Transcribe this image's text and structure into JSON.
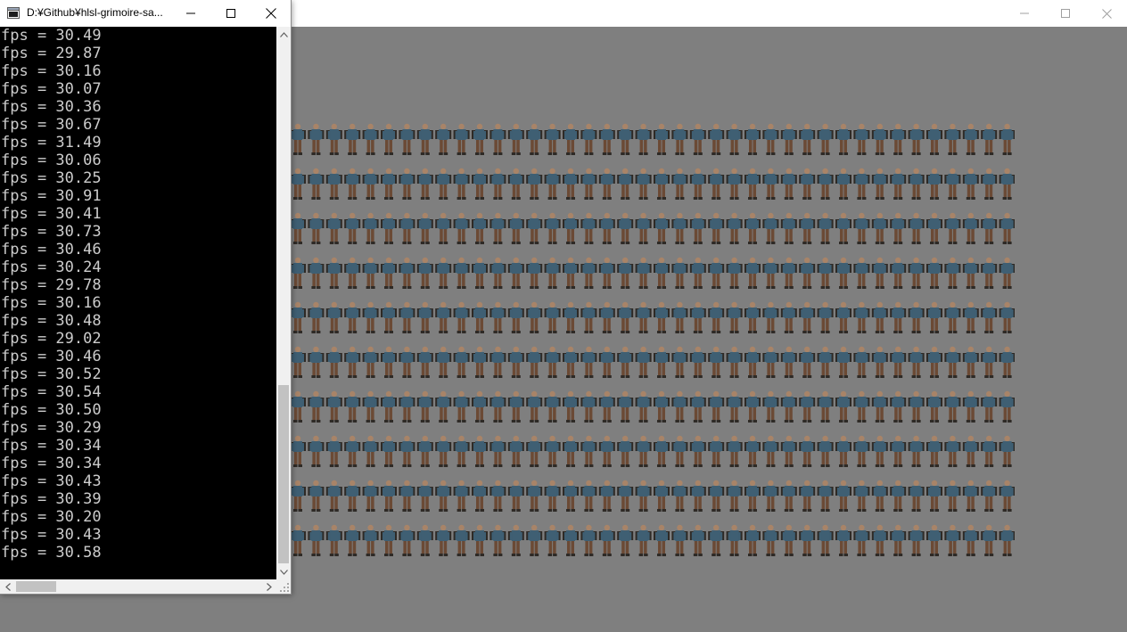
{
  "console": {
    "title": "D:¥Github¥hlsl-grimoire-sa...",
    "lines": [
      "fps = 30.49",
      "fps = 29.87",
      "fps = 30.16",
      "fps = 30.07",
      "fps = 30.36",
      "fps = 30.67",
      "fps = 31.49",
      "fps = 30.06",
      "fps = 30.25",
      "fps = 30.91",
      "fps = 30.41",
      "fps = 30.73",
      "fps = 30.46",
      "fps = 30.24",
      "fps = 29.78",
      "fps = 30.16",
      "fps = 30.48",
      "fps = 29.02",
      "fps = 30.46",
      "fps = 30.52",
      "fps = 30.54",
      "fps = 30.50",
      "fps = 30.29",
      "fps = 30.34",
      "fps = 30.34",
      "fps = 30.43",
      "fps = 30.39",
      "fps = 30.20",
      "fps = 30.43",
      "fps = 30.58"
    ],
    "icons": {
      "app": "console-app-icon",
      "minimize": "minimize-icon",
      "maximize": "maximize-icon",
      "close": "close-icon",
      "scroll_up": "chevron-up-icon",
      "scroll_down": "chevron-down-icon",
      "scroll_left": "chevron-left-icon",
      "scroll_right": "chevron-right-icon",
      "resize": "resize-grip-icon"
    }
  },
  "app_window": {
    "background": "#7f7f7f",
    "sprite_rows": 10,
    "sprites_per_row": 40,
    "sprite_colors": {
      "head": "#a88468",
      "jacket": "#3f5f73",
      "pants": "#6b4a35",
      "shadow": "#2e2a26"
    }
  },
  "colors": {
    "console_bg": "#000000",
    "console_text": "#cccccc",
    "titlebar": "#ffffff"
  }
}
